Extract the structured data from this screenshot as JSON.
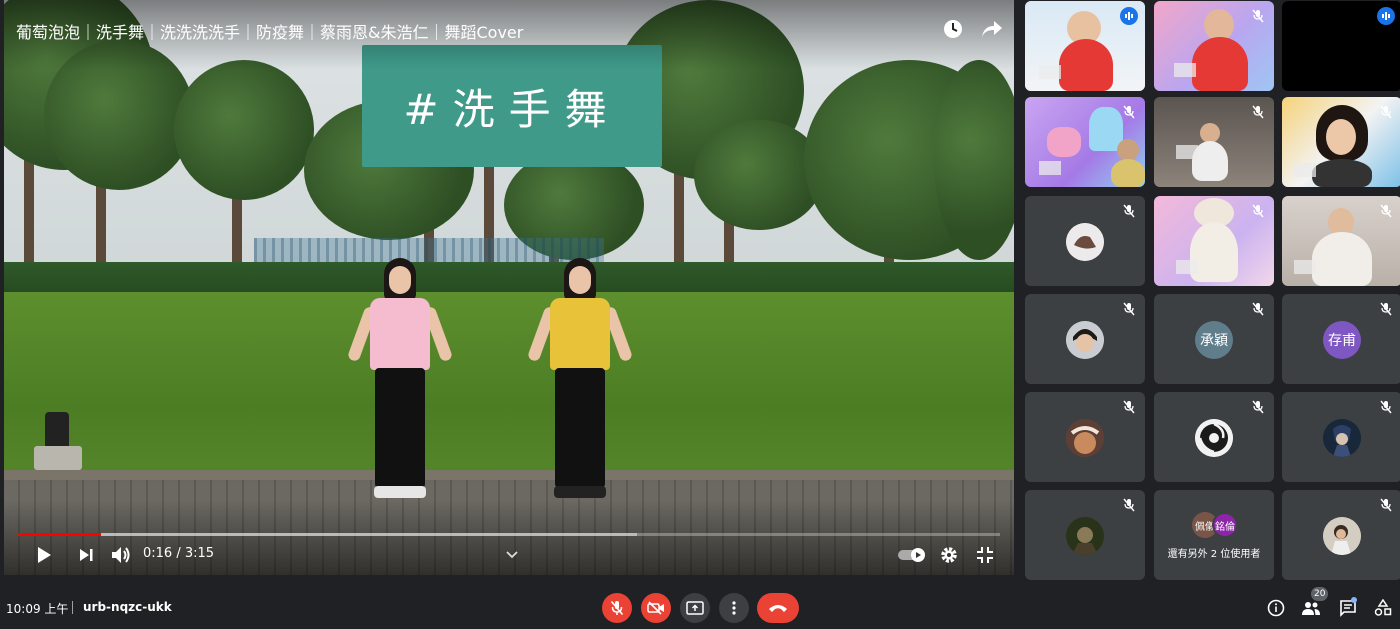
{
  "presentation": {
    "video_title": "葡萄泡泡｜洗手舞｜洗洗洗洗手｜防疫舞｜蔡雨恩&朱浩仁｜舞蹈Cover",
    "title_card": "#洗手舞",
    "time_display": "0:16 / 3:15",
    "progress_played": 0.085,
    "progress_buffered": 0.63
  },
  "participants": {
    "tiles": [
      {
        "label": "承穎"
      },
      {
        "label": "存甫"
      }
    ],
    "others": {
      "avatar_1": "佩儀",
      "avatar_2": "銘倫",
      "label": "還有另外 2 位使用者"
    }
  },
  "bottom_bar": {
    "clock": "10:09 上午",
    "meeting_code": "urb-nqzc-ukk",
    "people_count": "20"
  },
  "colors": {
    "background": "#202124",
    "tile": "#3c4043",
    "danger": "#ea4335",
    "accent": "#8ab4f8",
    "speaking": "#1a73e8",
    "progress": "#ff0000"
  }
}
